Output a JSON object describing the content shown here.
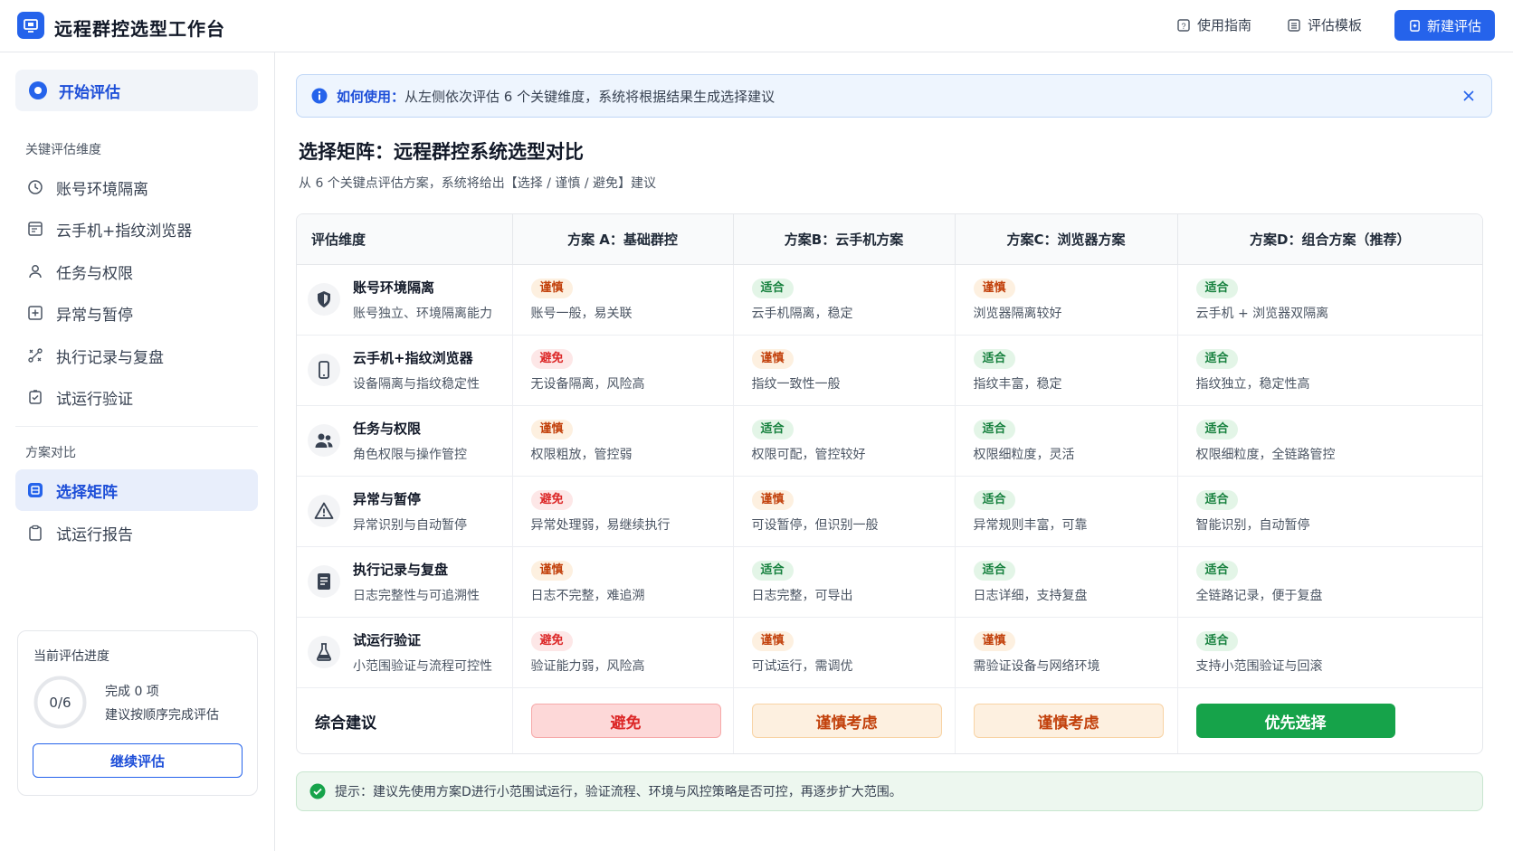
{
  "app": {
    "title": "远程群控选型工作台"
  },
  "header": {
    "guide_label": "使用指南",
    "template_label": "评估模板",
    "new_label": "新建评估"
  },
  "sidebar": {
    "start_label": "开始评估",
    "section_dimensions": "关键评估维度",
    "dimensions": [
      {
        "label": "账号环境隔离",
        "icon": "clock-icon"
      },
      {
        "label": "云手机+指纹浏览器",
        "icon": "browser-icon"
      },
      {
        "label": "任务与权限",
        "icon": "user-icon"
      },
      {
        "label": "异常与暂停",
        "icon": "plus-square-icon"
      },
      {
        "label": "执行记录与复盘",
        "icon": "path-icon"
      },
      {
        "label": "试运行验证",
        "icon": "check-square-icon"
      }
    ],
    "section_compare": "方案对比",
    "compare": [
      {
        "label": "选择矩阵",
        "icon": "matrix-icon",
        "active": true
      },
      {
        "label": "试运行报告",
        "icon": "clipboard-icon",
        "active": false
      }
    ],
    "progress": {
      "title": "当前评估进度",
      "value": "0/6",
      "done_text": "完成 0 项",
      "hint": "建议按顺序完成评估",
      "fraction": 0,
      "button": "继续评估"
    }
  },
  "banner": {
    "lead": "如何使用：",
    "text": "从左侧依次评估 6 个关键维度，系统将根据结果生成选择建议"
  },
  "main": {
    "title": "选择矩阵：远程群控系统选型对比",
    "subtitle": "从 6 个关键点评估方案，系统将给出【选择 / 谨慎 / 避免】建议"
  },
  "matrix": {
    "headers": [
      "评估维度",
      "方案 A：基础群控",
      "方案B：云手机方案",
      "方案C：浏览器方案",
      "方案D：组合方案（推荐）"
    ],
    "rows": [
      {
        "name": "账号环境隔离",
        "desc": "账号独立、环境隔离能力",
        "icon": "shield-icon",
        "cells": [
          {
            "badge": "谨慎",
            "level": "warn",
            "text": "账号一般，易关联"
          },
          {
            "badge": "适合",
            "level": "ok",
            "text": "云手机隔离，稳定"
          },
          {
            "badge": "谨慎",
            "level": "warn",
            "text": "浏览器隔离较好"
          },
          {
            "badge": "适合",
            "level": "ok",
            "text": "云手机 + 浏览器双隔离"
          }
        ]
      },
      {
        "name": "云手机+指纹浏览器",
        "desc": "设备隔离与指纹稳定性",
        "icon": "phone-icon",
        "cells": [
          {
            "badge": "避免",
            "level": "bad",
            "text": "无设备隔离，风险高"
          },
          {
            "badge": "谨慎",
            "level": "warn",
            "text": "指纹一致性一般"
          },
          {
            "badge": "适合",
            "level": "ok",
            "text": "指纹丰富，稳定"
          },
          {
            "badge": "适合",
            "level": "ok",
            "text": "指纹独立，稳定性高"
          }
        ]
      },
      {
        "name": "任务与权限",
        "desc": "角色权限与操作管控",
        "icon": "users-icon",
        "cells": [
          {
            "badge": "谨慎",
            "level": "warn",
            "text": "权限粗放，管控弱"
          },
          {
            "badge": "适合",
            "level": "ok",
            "text": "权限可配，管控较好"
          },
          {
            "badge": "适合",
            "level": "ok",
            "text": "权限细粒度，灵活"
          },
          {
            "badge": "适合",
            "level": "ok",
            "text": "权限细粒度，全链路管控"
          }
        ]
      },
      {
        "name": "异常与暂停",
        "desc": "异常识别与自动暂停",
        "icon": "warning-icon",
        "cells": [
          {
            "badge": "避免",
            "level": "bad",
            "text": "异常处理弱，易继续执行"
          },
          {
            "badge": "谨慎",
            "level": "warn",
            "text": "可设暂停，但识别一般"
          },
          {
            "badge": "适合",
            "level": "ok",
            "text": "异常规则丰富，可靠"
          },
          {
            "badge": "适合",
            "level": "ok",
            "text": "智能识别，自动暂停"
          }
        ]
      },
      {
        "name": "执行记录与复盘",
        "desc": "日志完整性与可追溯性",
        "icon": "document-icon",
        "cells": [
          {
            "badge": "谨慎",
            "level": "warn",
            "text": "日志不完整，难追溯"
          },
          {
            "badge": "适合",
            "level": "ok",
            "text": "日志完整，可导出"
          },
          {
            "badge": "适合",
            "level": "ok",
            "text": "日志详细，支持复盘"
          },
          {
            "badge": "适合",
            "level": "ok",
            "text": "全链路记录，便于复盘"
          }
        ]
      },
      {
        "name": "试运行验证",
        "desc": "小范围验证与流程可控性",
        "icon": "flask-icon",
        "cells": [
          {
            "badge": "避免",
            "level": "bad",
            "text": "验证能力弱，风险高"
          },
          {
            "badge": "谨慎",
            "level": "warn",
            "text": "可试运行，需调优"
          },
          {
            "badge": "谨慎",
            "level": "warn",
            "text": "需验证设备与网络环境"
          },
          {
            "badge": "适合",
            "level": "ok",
            "text": "支持小范围验证与回滚"
          }
        ]
      }
    ],
    "summary": {
      "label": "综合建议",
      "cells": [
        {
          "text": "避免",
          "level": "bad"
        },
        {
          "text": "谨慎考虑",
          "level": "warn"
        },
        {
          "text": "谨慎考虑",
          "level": "warn"
        },
        {
          "text": "优先选择",
          "level": "ok"
        }
      ]
    }
  },
  "tip": {
    "text": "提示：建议先使用方案D进行小范围试运行，验证流程、环境与风控策略是否可控，再逐步扩大范围。"
  },
  "colors": {
    "accent": "#2563eb",
    "ok": "#16a34a",
    "warn": "#c2410c",
    "bad": "#dc2626"
  }
}
